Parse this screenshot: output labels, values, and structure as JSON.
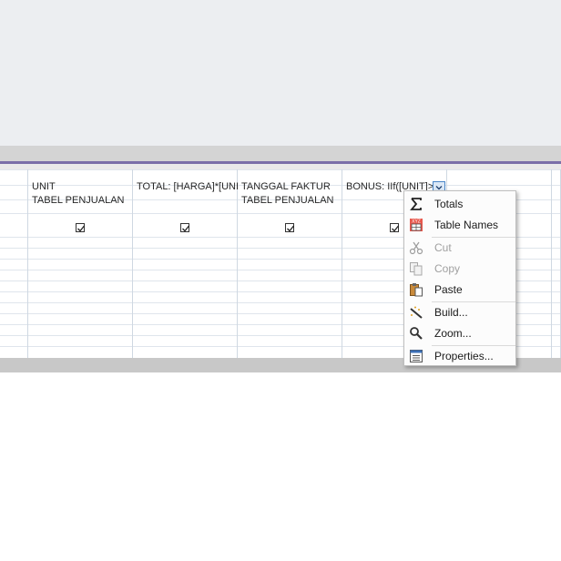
{
  "grid": {
    "columns": [
      {
        "field": "",
        "table": ""
      },
      {
        "field": "UNIT",
        "table": "TABEL PENJUALAN"
      },
      {
        "field": "TOTAL: [HARGA]*[UNIT]",
        "table": ""
      },
      {
        "field": "TANGGAL FAKTUR",
        "table": "TABEL PENJUALAN"
      },
      {
        "field": "BONUS: IIf([UNIT]>",
        "table": ""
      }
    ]
  },
  "context_menu": {
    "items": [
      {
        "label": "Totals",
        "icon": "sigma-icon",
        "enabled": true
      },
      {
        "label": "Table Names",
        "icon": "table-names-icon",
        "enabled": true
      },
      {
        "label": "Cut",
        "icon": "scissors-icon",
        "enabled": false
      },
      {
        "label": "Copy",
        "icon": "copy-icon",
        "enabled": false
      },
      {
        "label": "Paste",
        "icon": "paste-icon",
        "enabled": true
      },
      {
        "label": "Build...",
        "icon": "build-wand-icon",
        "enabled": true
      },
      {
        "label": "Zoom...",
        "icon": "magnifier-icon",
        "enabled": true
      },
      {
        "label": "Properties...",
        "icon": "properties-sheet-icon",
        "enabled": true
      }
    ]
  },
  "colors": {
    "accent_bar": "#7a6fa8",
    "grid_line": "#cfd8e2",
    "menu_bg": "#fcfcfc"
  }
}
